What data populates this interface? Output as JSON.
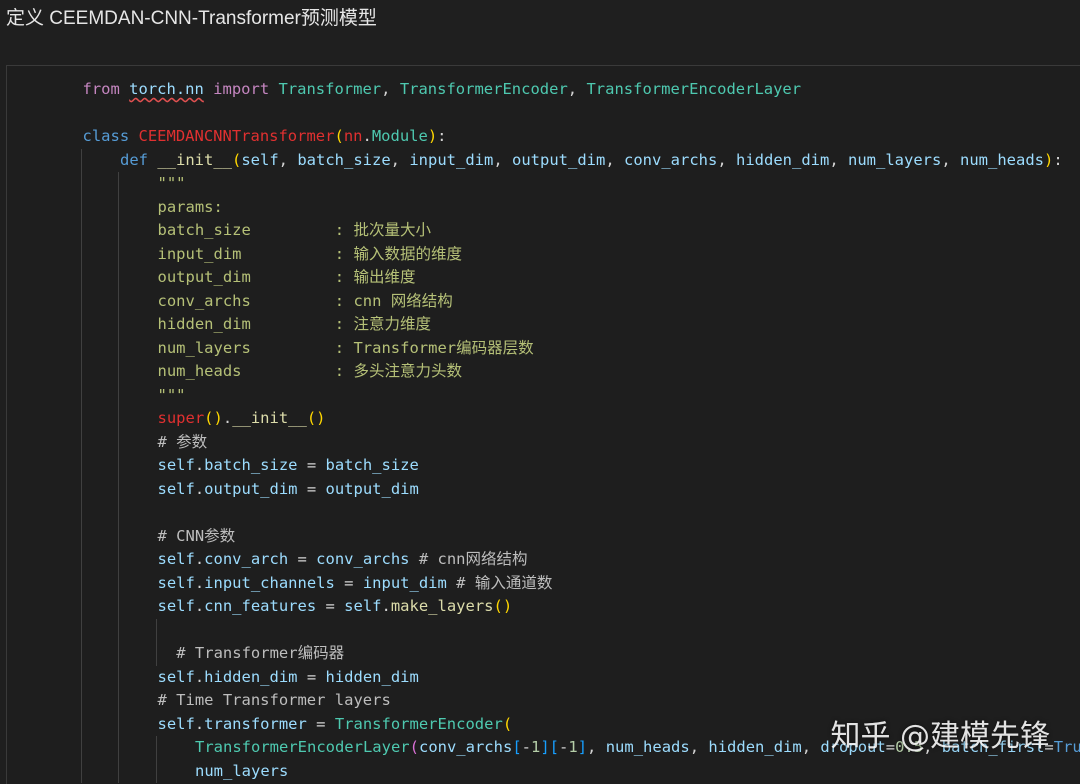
{
  "heading": "定义 CEEMDAN-CNN-Transformer预测模型",
  "watermark": "知乎 @建模先锋",
  "code": [
    {
      "indent": 1,
      "guides": [],
      "tokens": [
        {
          "c": "kw",
          "t": "from "
        },
        {
          "c": "v squig",
          "t": "torch.nn"
        },
        {
          "c": "kw",
          "t": " import "
        },
        {
          "c": "cls",
          "t": "Transformer"
        },
        {
          "c": "op",
          "t": ", "
        },
        {
          "c": "cls",
          "t": "TransformerEncoder"
        },
        {
          "c": "op",
          "t": ", "
        },
        {
          "c": "cls",
          "t": "TransformerEncoderLayer"
        }
      ]
    },
    {
      "indent": 0,
      "guides": [],
      "tokens": []
    },
    {
      "indent": 1,
      "guides": [],
      "tokens": [
        {
          "c": "k",
          "t": "class "
        },
        {
          "c": "red",
          "t": "CEEMDANCNNTransformer"
        },
        {
          "c": "p1",
          "t": "("
        },
        {
          "c": "red",
          "t": "nn"
        },
        {
          "c": "op",
          "t": "."
        },
        {
          "c": "cls",
          "t": "Module"
        },
        {
          "c": "p1",
          "t": ")"
        },
        {
          "c": "op",
          "t": ":"
        }
      ]
    },
    {
      "indent": 2,
      "guides": [
        1
      ],
      "tokens": [
        {
          "c": "k",
          "t": "def "
        },
        {
          "c": "f",
          "t": "__init__"
        },
        {
          "c": "p1",
          "t": "("
        },
        {
          "c": "v",
          "t": "self"
        },
        {
          "c": "op",
          "t": ", "
        },
        {
          "c": "v",
          "t": "batch_size"
        },
        {
          "c": "op",
          "t": ", "
        },
        {
          "c": "v",
          "t": "input_dim"
        },
        {
          "c": "op",
          "t": ", "
        },
        {
          "c": "v",
          "t": "output_dim"
        },
        {
          "c": "op",
          "t": ", "
        },
        {
          "c": "v",
          "t": "conv_archs"
        },
        {
          "c": "op",
          "t": ", "
        },
        {
          "c": "v",
          "t": "hidden_dim"
        },
        {
          "c": "op",
          "t": ", "
        },
        {
          "c": "v",
          "t": "num_layers"
        },
        {
          "c": "op",
          "t": ", "
        },
        {
          "c": "v",
          "t": "num_heads"
        },
        {
          "c": "p1",
          "t": ")"
        },
        {
          "c": "op",
          "t": ":"
        }
      ]
    },
    {
      "indent": 3,
      "guides": [
        1,
        2
      ],
      "tokens": [
        {
          "c": "ds",
          "t": "\"\"\""
        }
      ]
    },
    {
      "indent": 3,
      "guides": [
        1,
        2
      ],
      "tokens": [
        {
          "c": "ds",
          "t": "params:"
        }
      ]
    },
    {
      "indent": 3,
      "guides": [
        1,
        2
      ],
      "tokens": [
        {
          "c": "ds",
          "t": "batch_size         : 批次量大小"
        }
      ]
    },
    {
      "indent": 3,
      "guides": [
        1,
        2
      ],
      "tokens": [
        {
          "c": "ds",
          "t": "input_dim          : 输入数据的维度"
        }
      ]
    },
    {
      "indent": 3,
      "guides": [
        1,
        2
      ],
      "tokens": [
        {
          "c": "ds",
          "t": "output_dim         : 输出维度"
        }
      ]
    },
    {
      "indent": 3,
      "guides": [
        1,
        2
      ],
      "tokens": [
        {
          "c": "ds",
          "t": "conv_archs         : cnn 网络结构"
        }
      ]
    },
    {
      "indent": 3,
      "guides": [
        1,
        2
      ],
      "tokens": [
        {
          "c": "ds",
          "t": "hidden_dim         : 注意力维度"
        }
      ]
    },
    {
      "indent": 3,
      "guides": [
        1,
        2
      ],
      "tokens": [
        {
          "c": "ds",
          "t": "num_layers         : Transformer编码器层数"
        }
      ]
    },
    {
      "indent": 3,
      "guides": [
        1,
        2
      ],
      "tokens": [
        {
          "c": "ds",
          "t": "num_heads          : 多头注意力头数"
        }
      ]
    },
    {
      "indent": 3,
      "guides": [
        1,
        2
      ],
      "tokens": [
        {
          "c": "ds",
          "t": "\"\"\""
        }
      ]
    },
    {
      "indent": 3,
      "guides": [
        1,
        2
      ],
      "tokens": [
        {
          "c": "red",
          "t": "super"
        },
        {
          "c": "p1",
          "t": "()"
        },
        {
          "c": "op",
          "t": "."
        },
        {
          "c": "f",
          "t": "__init__"
        },
        {
          "c": "p1",
          "t": "()"
        }
      ]
    },
    {
      "indent": 3,
      "guides": [
        1,
        2
      ],
      "tokens": [
        {
          "c": "c2",
          "t": "# 参数"
        }
      ]
    },
    {
      "indent": 3,
      "guides": [
        1,
        2
      ],
      "tokens": [
        {
          "c": "v",
          "t": "self"
        },
        {
          "c": "op",
          "t": "."
        },
        {
          "c": "v",
          "t": "batch_size"
        },
        {
          "c": "op",
          "t": " = "
        },
        {
          "c": "v",
          "t": "batch_size"
        }
      ]
    },
    {
      "indent": 3,
      "guides": [
        1,
        2
      ],
      "tokens": [
        {
          "c": "v",
          "t": "self"
        },
        {
          "c": "op",
          "t": "."
        },
        {
          "c": "v",
          "t": "output_dim"
        },
        {
          "c": "op",
          "t": " = "
        },
        {
          "c": "v",
          "t": "output_dim"
        }
      ]
    },
    {
      "indent": 0,
      "guides": [
        1,
        2
      ],
      "tokens": []
    },
    {
      "indent": 3,
      "guides": [
        1,
        2
      ],
      "tokens": [
        {
          "c": "c2",
          "t": "# CNN参数"
        }
      ]
    },
    {
      "indent": 3,
      "guides": [
        1,
        2
      ],
      "tokens": [
        {
          "c": "v",
          "t": "self"
        },
        {
          "c": "op",
          "t": "."
        },
        {
          "c": "v",
          "t": "conv_arch"
        },
        {
          "c": "op",
          "t": " = "
        },
        {
          "c": "v",
          "t": "conv_archs"
        },
        {
          "c": "c2",
          "t": " # cnn网络结构"
        }
      ]
    },
    {
      "indent": 3,
      "guides": [
        1,
        2
      ],
      "tokens": [
        {
          "c": "v",
          "t": "self"
        },
        {
          "c": "op",
          "t": "."
        },
        {
          "c": "v",
          "t": "input_channels"
        },
        {
          "c": "op",
          "t": " = "
        },
        {
          "c": "v",
          "t": "input_dim"
        },
        {
          "c": "c2",
          "t": " # 输入通道数"
        }
      ]
    },
    {
      "indent": 3,
      "guides": [
        1,
        2
      ],
      "tokens": [
        {
          "c": "v",
          "t": "self"
        },
        {
          "c": "op",
          "t": "."
        },
        {
          "c": "v",
          "t": "cnn_features"
        },
        {
          "c": "op",
          "t": " = "
        },
        {
          "c": "v",
          "t": "self"
        },
        {
          "c": "op",
          "t": "."
        },
        {
          "c": "f",
          "t": "make_layers"
        },
        {
          "c": "p1",
          "t": "()"
        }
      ]
    },
    {
      "indent": 0,
      "guides": [
        1,
        2,
        3
      ],
      "tokens": []
    },
    {
      "indent": 3.5,
      "guides": [
        1,
        2,
        3
      ],
      "tokens": [
        {
          "c": "c2",
          "t": "# Transformer编码器"
        }
      ]
    },
    {
      "indent": 3,
      "guides": [
        1,
        2
      ],
      "tokens": [
        {
          "c": "v",
          "t": "self"
        },
        {
          "c": "op",
          "t": "."
        },
        {
          "c": "v",
          "t": "hidden_dim"
        },
        {
          "c": "op",
          "t": " = "
        },
        {
          "c": "v",
          "t": "hidden_dim"
        }
      ]
    },
    {
      "indent": 3,
      "guides": [
        1,
        2
      ],
      "tokens": [
        {
          "c": "c2",
          "t": "# Time Transformer layers"
        }
      ]
    },
    {
      "indent": 3,
      "guides": [
        1,
        2
      ],
      "tokens": [
        {
          "c": "v",
          "t": "self"
        },
        {
          "c": "op",
          "t": "."
        },
        {
          "c": "v",
          "t": "transformer"
        },
        {
          "c": "op",
          "t": " = "
        },
        {
          "c": "cls",
          "t": "TransformerEncoder"
        },
        {
          "c": "p1",
          "t": "("
        }
      ]
    },
    {
      "indent": 4,
      "guides": [
        1,
        2,
        3
      ],
      "tokens": [
        {
          "c": "cls",
          "t": "TransformerEncoderLayer"
        },
        {
          "c": "p2",
          "t": "("
        },
        {
          "c": "v",
          "t": "conv_archs"
        },
        {
          "c": "p3",
          "t": "["
        },
        {
          "c": "op",
          "t": "-"
        },
        {
          "c": "n",
          "t": "1"
        },
        {
          "c": "p3",
          "t": "]["
        },
        {
          "c": "op",
          "t": "-"
        },
        {
          "c": "n",
          "t": "1"
        },
        {
          "c": "p3",
          "t": "]"
        },
        {
          "c": "op",
          "t": ", "
        },
        {
          "c": "v",
          "t": "num_heads"
        },
        {
          "c": "op",
          "t": ", "
        },
        {
          "c": "v",
          "t": "hidden_dim"
        },
        {
          "c": "op",
          "t": ", "
        },
        {
          "c": "v",
          "t": "dropout"
        },
        {
          "c": "op",
          "t": "="
        },
        {
          "c": "n",
          "t": "0.5"
        },
        {
          "c": "op",
          "t": ", "
        },
        {
          "c": "v",
          "t": "batch_first"
        },
        {
          "c": "op",
          "t": "="
        },
        {
          "c": "k",
          "t": "True"
        },
        {
          "c": "p2",
          "t": ")"
        },
        {
          "c": "op",
          "t": ","
        }
      ]
    },
    {
      "indent": 4,
      "guides": [
        1,
        2,
        3
      ],
      "tokens": [
        {
          "c": "v",
          "t": "num_layers"
        }
      ]
    }
  ]
}
